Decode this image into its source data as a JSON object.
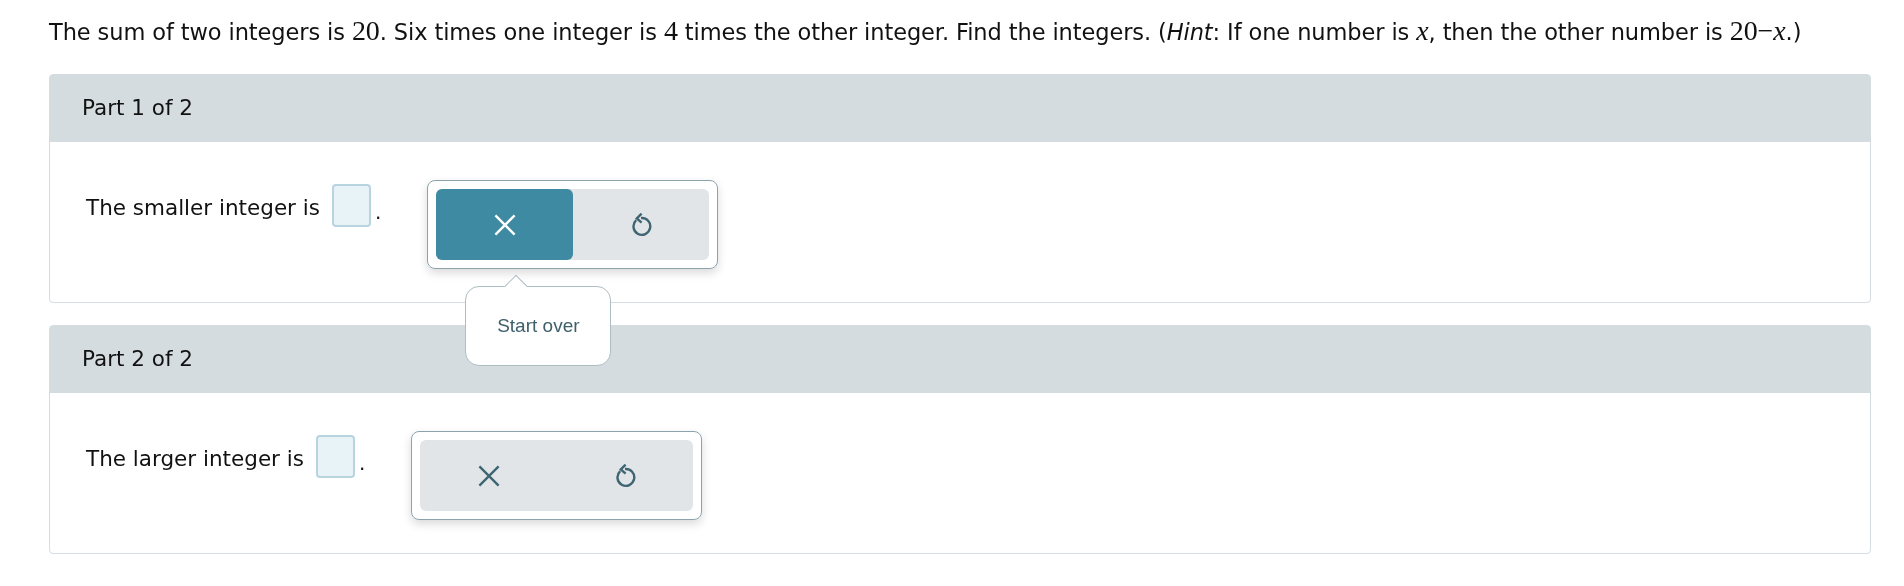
{
  "question": [
    {
      "kind": "text",
      "text": "The sum of two integers is "
    },
    {
      "kind": "math",
      "text": "20"
    },
    {
      "kind": "text",
      "text": ". Six times one integer is "
    },
    {
      "kind": "math",
      "text": "4"
    },
    {
      "kind": "text",
      "text": " times the other integer. Find the integers. ("
    },
    {
      "kind": "text",
      "text": "*Hint*: If one number is "
    },
    {
      "kind": "math",
      "text": "*x*"
    },
    {
      "kind": "text",
      "text": ", then the other number is "
    },
    {
      "kind": "math",
      "text": "20−*x*"
    },
    {
      "kind": "text",
      "text": ".)"
    }
  ],
  "parts": [
    {
      "title": "Part 1 of 2",
      "prompt": "The smaller integer is",
      "after": ".",
      "tools": [
        {
          "kind": "clear",
          "hovered": true,
          "tooltip": "Start over"
        },
        {
          "kind": "undo",
          "hovered": false
        }
      ]
    },
    {
      "title": "Part 2 of 2",
      "prompt": "The larger integer is",
      "after": ".",
      "tools": [
        {
          "kind": "clear",
          "hovered": false
        },
        {
          "kind": "undo",
          "hovered": false
        }
      ]
    }
  ]
}
